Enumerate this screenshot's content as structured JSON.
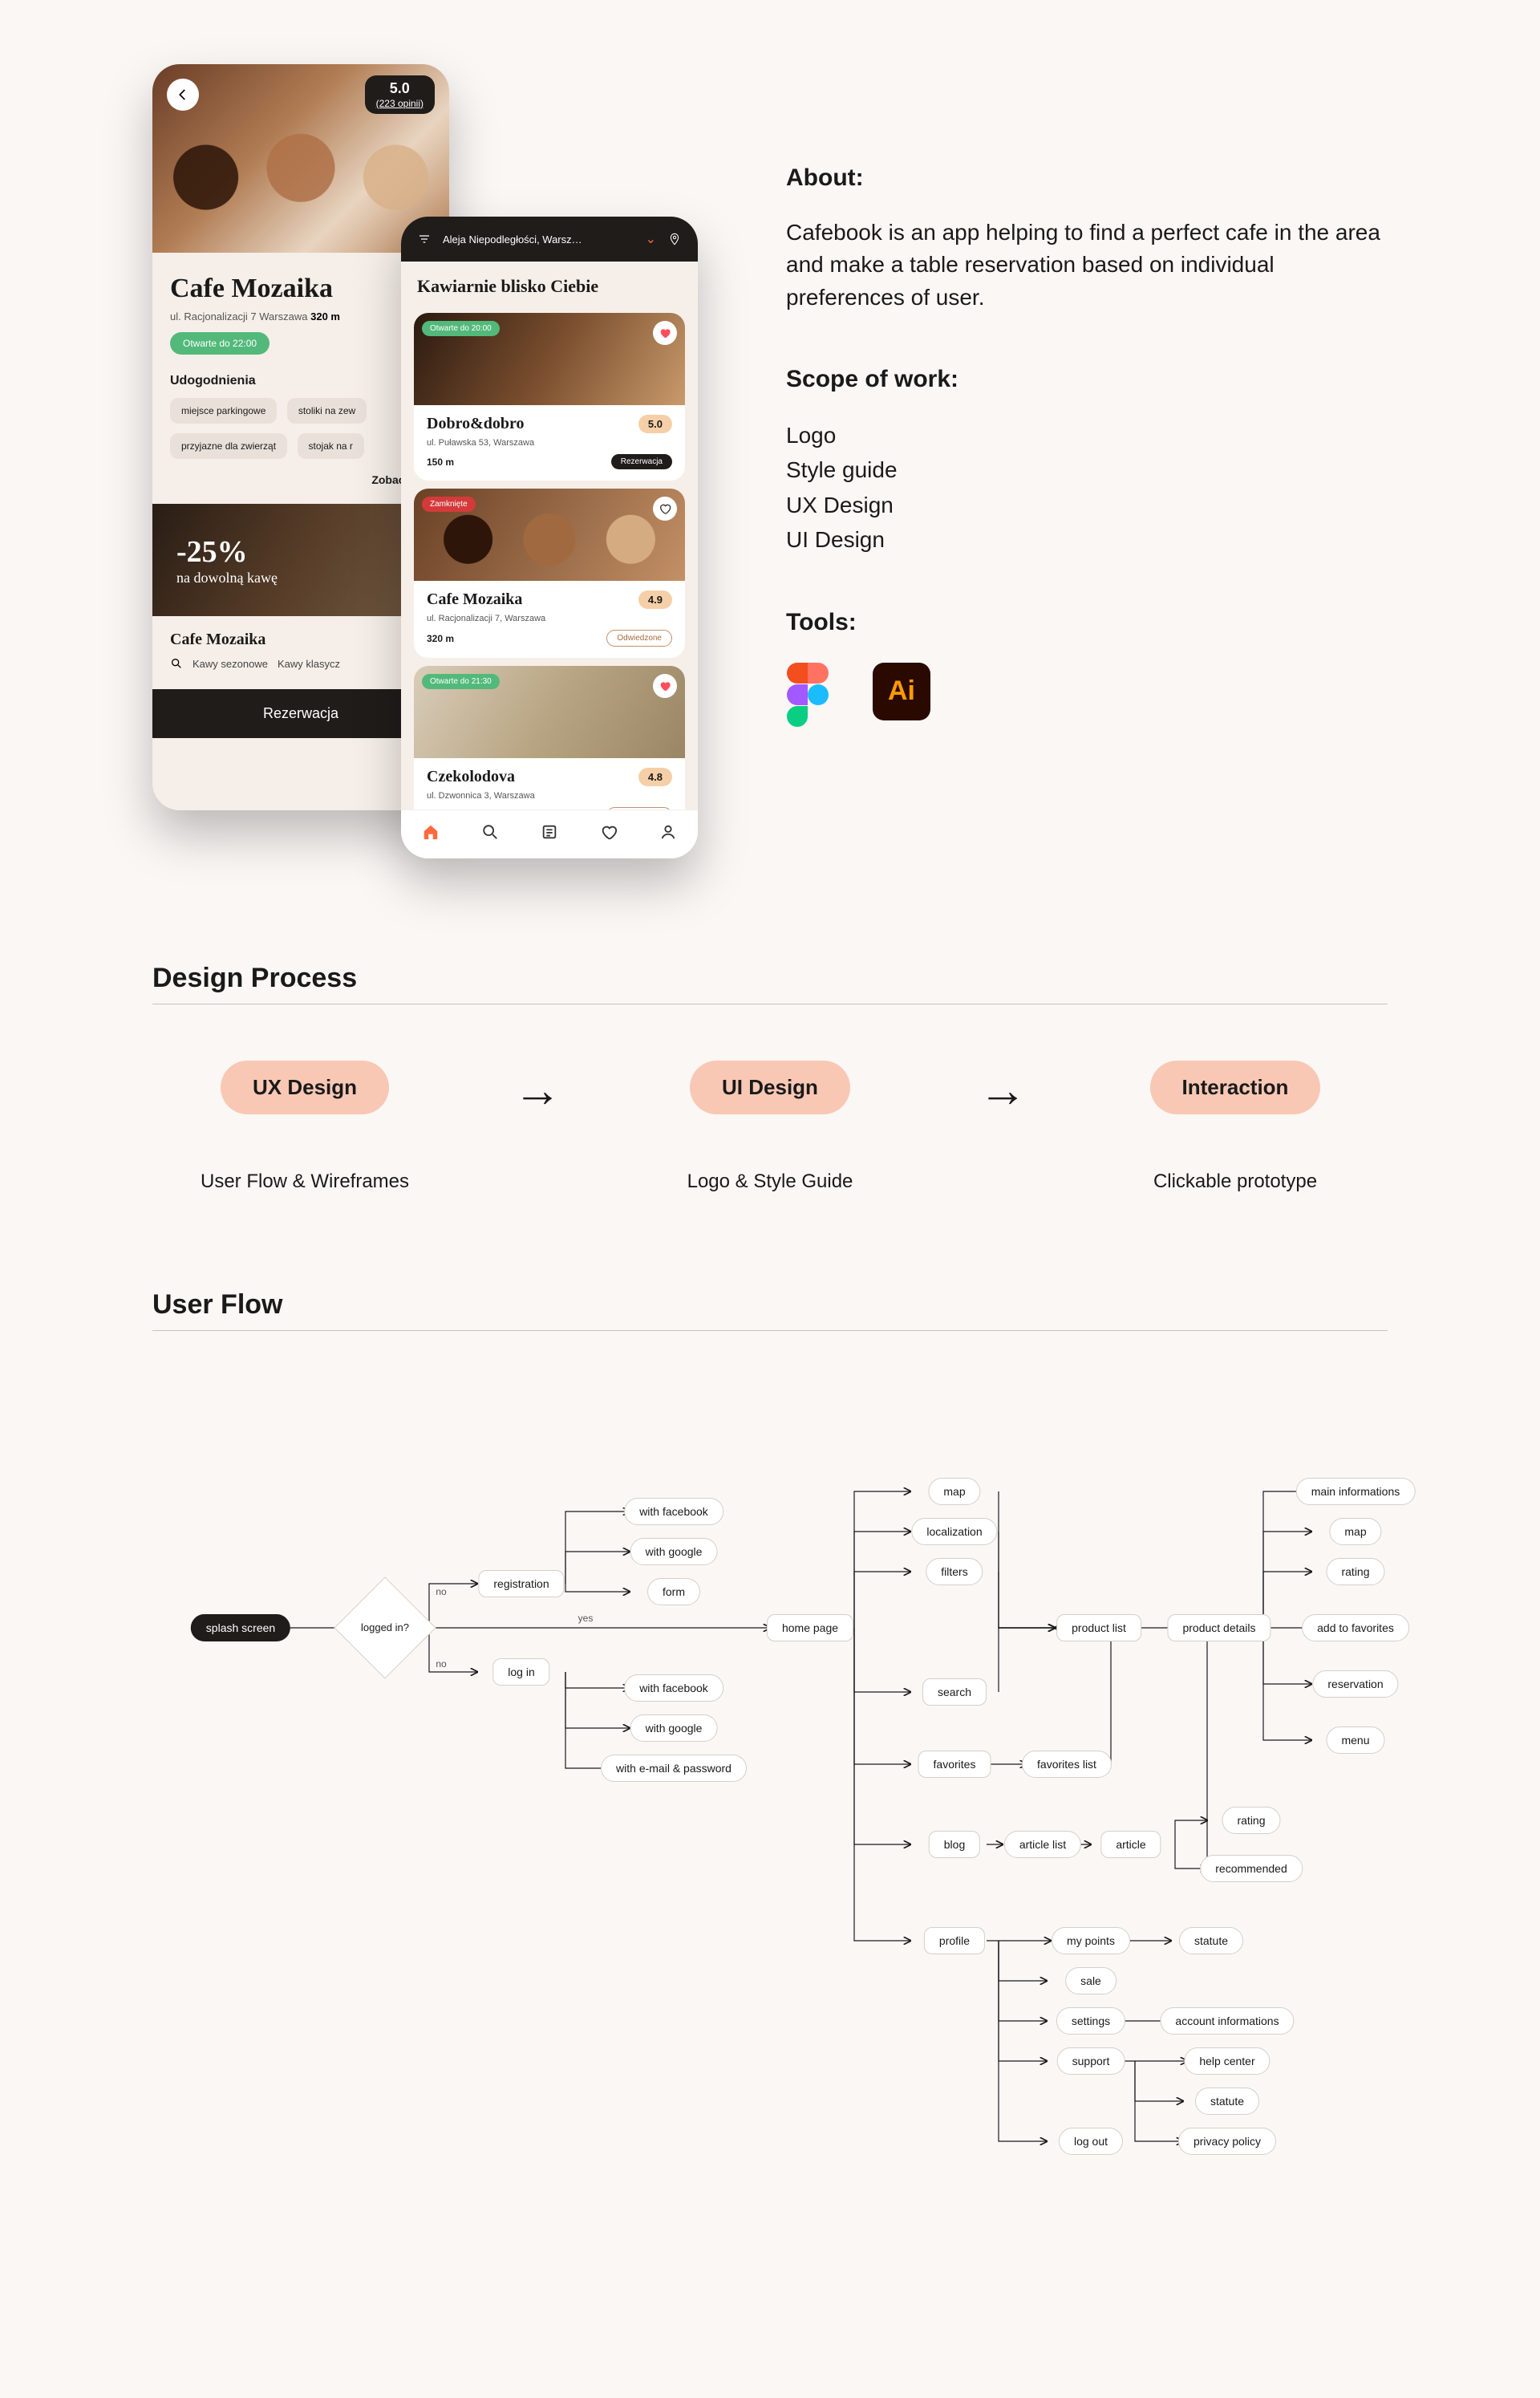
{
  "about": {
    "heading": "About:",
    "text": "Cafebook is an app helping to find a perfect cafe in the area and make a table reservation based on individual preferences of user.",
    "scope_heading": "Scope of work:",
    "scope_items": [
      "Logo",
      "Style guide",
      "UX Design",
      "UI Design"
    ],
    "tools_heading": "Tools:",
    "tools": [
      "Figma",
      "Adobe Illustrator"
    ]
  },
  "phone_back": {
    "rating": "5.0",
    "rating_count": "(223 opinii)",
    "title": "Cafe Mozaika",
    "address": "ul. Racjonalizacji 7 Warszawa",
    "distance": "320 m",
    "open_badge": "Otwarte do 22:00",
    "amenities_heading": "Udogodnienia",
    "tags": [
      "miejsce parkingowe",
      "stoliki na zew",
      "przyjazne dla zwierząt",
      "stojak na r"
    ],
    "more": "Zobacz wię",
    "promo_big": "-25%",
    "promo_small": "na dowolną kawę",
    "card_title": "Cafe Mozaika",
    "search_terms": [
      "Kawy sezonowe",
      "Kawy klasycz"
    ],
    "cta": "Rezerwacja"
  },
  "phone_front": {
    "location": "Aleja Niepodległości, Warsz…",
    "heading": "Kawiarnie blisko Ciebie",
    "cards": [
      {
        "status": "Otwarte do 20:00",
        "status_color": "green",
        "name": "Dobro&dobro",
        "rating": "5.0",
        "address": "ul. Puławska 53, Warszawa",
        "distance": "150 m",
        "chip": "Rezerwacja",
        "chip_style": "dark",
        "img": "coffee",
        "heart": "red"
      },
      {
        "status": "Zamknięte",
        "status_color": "red",
        "name": "Cafe Mozaika",
        "rating": "4.9",
        "address": "ul. Racjonalizacji 7, Warszawa",
        "distance": "320 m",
        "chip": "Odwiedzone",
        "chip_style": "outline",
        "img": "lattes",
        "heart": "outline"
      },
      {
        "status": "Otwarte do 21:30",
        "status_color": "green",
        "name": "Czekolodova",
        "rating": "4.8",
        "address": "ul. Dzwonnica 3, Warszawa",
        "distance": "",
        "chip": "Odwiedzone",
        "chip_style": "outline",
        "img": "bikes",
        "heart": "red"
      }
    ],
    "nav": [
      "home",
      "search",
      "news",
      "favorites",
      "profile"
    ]
  },
  "sections": {
    "design_process": "Design Process",
    "user_flow": "User Flow"
  },
  "design_process": {
    "steps": [
      {
        "pill": "UX Design",
        "caption": "User Flow & Wireframes"
      },
      {
        "pill": "UI Design",
        "caption": "Logo & Style Guide"
      },
      {
        "pill": "Interaction",
        "caption": "Clickable prototype"
      }
    ]
  },
  "user_flow": {
    "nodes": {
      "splash": "splash screen",
      "logged": "logged in?",
      "no": "no",
      "yes": "yes",
      "registration": "registration",
      "login": "log in",
      "reg_fb": "with facebook",
      "reg_google": "with google",
      "reg_form": "form",
      "login_fb": "with facebook",
      "login_google": "with google",
      "login_email": "with e-mail & password",
      "home": "home page",
      "map": "map",
      "localization": "localization",
      "filters": "filters",
      "search": "search",
      "favorites": "favorites",
      "fav_list": "favorites list",
      "blog": "blog",
      "article_list": "article list",
      "article": "article",
      "art_rating": "rating",
      "art_recommended": "recommended",
      "profile": "profile",
      "my_points": "my points",
      "statute": "statute",
      "sale": "sale",
      "settings": "settings",
      "account_info": "account informations",
      "support": "support",
      "help_center": "help center",
      "statute2": "statute",
      "privacy": "privacy policy",
      "logout": "log out",
      "product_list": "product list",
      "product_details": "product details",
      "pd_main": "main informations",
      "pd_map": "map",
      "pd_rating": "rating",
      "pd_fav": "add to favorites",
      "pd_res": "reservation",
      "pd_menu": "menu"
    }
  }
}
